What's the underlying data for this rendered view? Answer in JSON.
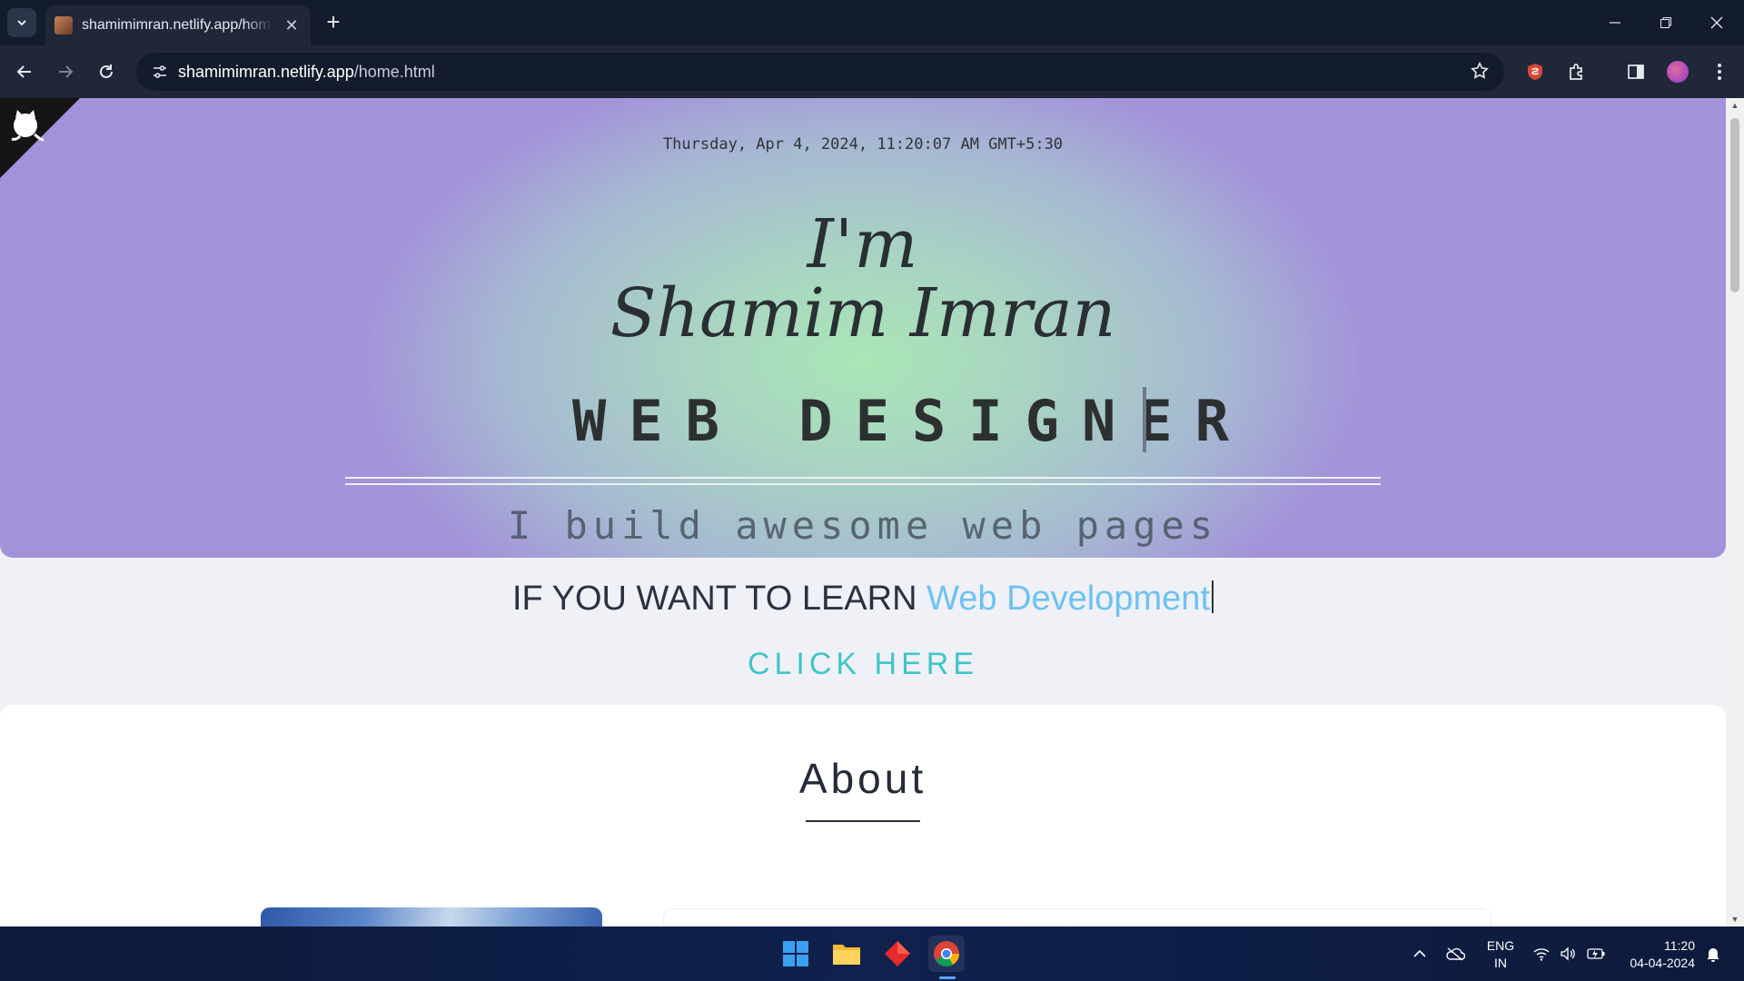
{
  "browser": {
    "tab_title": "shamimimran.netlify.app/home.html",
    "new_tab": "+",
    "tab_close": "✕",
    "url_host": "shamimimran.netlify.app",
    "url_path": "/home.html"
  },
  "hero": {
    "datetime": "Thursday, Apr 4, 2024, 11:20:07 AM GMT+5:30",
    "greeting": "I'm",
    "name": "Shamim Imran",
    "role": "WEB DESIGNER",
    "tagline": "I build awesome web pages"
  },
  "learn": {
    "prefix": "IF YOU WANT TO LEARN ",
    "highlight": "Web Development",
    "cta": "CLICK HERE"
  },
  "about": {
    "heading": "About"
  },
  "taskbar": {
    "lang_line1": "ENG",
    "lang_line2": "IN",
    "time": "11:20",
    "date": "04-04-2024"
  },
  "colors": {
    "accent_blue": "#6cc2f5",
    "accent_teal": "#3fc6c8",
    "hero_center": "#a9e6b6",
    "hero_edge": "#a391da"
  }
}
